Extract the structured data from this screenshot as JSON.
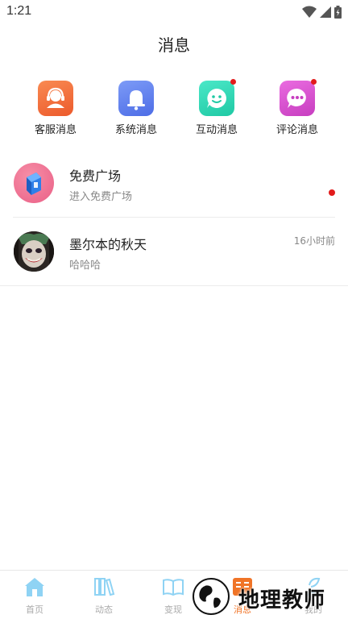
{
  "status_bar": {
    "time": "1:21"
  },
  "header": {
    "title": "消息"
  },
  "quick_actions": [
    {
      "label": "客服消息",
      "icon": "headset-agent-icon",
      "color": "#f26b3b",
      "badge": false
    },
    {
      "label": "系统消息",
      "icon": "bell-icon",
      "color": "#5b7ef0",
      "badge": false
    },
    {
      "label": "互动消息",
      "icon": "smiley-chat-icon",
      "color": "#2ed9b3",
      "badge": true
    },
    {
      "label": "评论消息",
      "icon": "comment-bubble-icon",
      "color": "#d84fd0",
      "badge": true
    }
  ],
  "messages": [
    {
      "title": "免费广场",
      "subtitle": "进入免费广场",
      "time": "",
      "unread": true,
      "avatar": "free-plaza-avatar"
    },
    {
      "title": "墨尔本的秋天",
      "subtitle": "哈哈哈",
      "time": "16小时前",
      "unread": false,
      "avatar": "joker-avatar"
    }
  ],
  "bottom_nav": [
    {
      "label": "首页",
      "icon": "home-icon",
      "active": false
    },
    {
      "label": "动态",
      "icon": "books-icon",
      "active": false
    },
    {
      "label": "变现",
      "icon": "open-book-icon",
      "active": false
    },
    {
      "label": "消息",
      "icon": "message-icon",
      "active": true
    },
    {
      "label": "我的",
      "icon": "profile-icon",
      "active": false
    }
  ],
  "watermark": {
    "text": "地理教师"
  },
  "colors": {
    "accent": "#f07427",
    "nav_inactive": "#8fd3f4",
    "unread_dot": "#e21b1b"
  }
}
